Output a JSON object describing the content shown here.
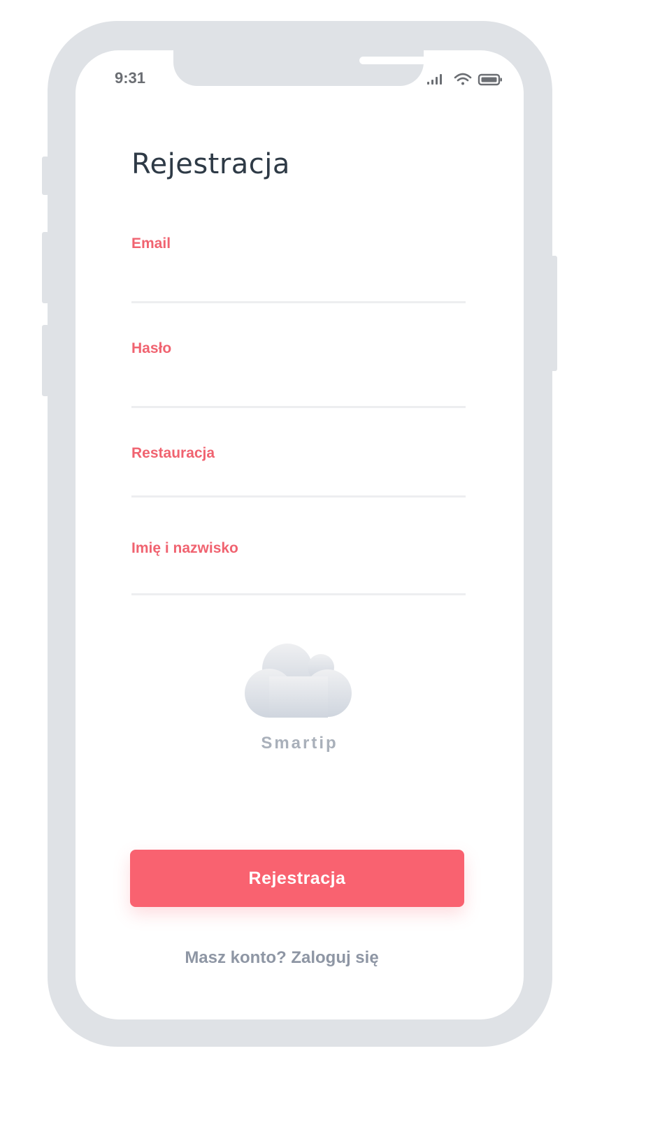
{
  "status_bar": {
    "time": "9:31",
    "icons": [
      "signal-icon",
      "wifi-icon",
      "battery-icon"
    ]
  },
  "page": {
    "title": "Rejestracja"
  },
  "form": {
    "fields": [
      {
        "label": "Email",
        "value": ""
      },
      {
        "label": "Hasło",
        "value": ""
      },
      {
        "label": "Restauracja",
        "value": ""
      },
      {
        "label": "Imię i nazwisko",
        "value": ""
      }
    ]
  },
  "logo": {
    "name": "Smartip",
    "icon": "cloud-icon"
  },
  "actions": {
    "register_label": "Rejestracja",
    "login_link": "Masz konto? Zaloguj się"
  },
  "colors": {
    "accent": "#f96270",
    "label": "#f06370",
    "title": "#2e3a46",
    "frame": "#dfe2e6",
    "muted": "#8e96a4"
  }
}
